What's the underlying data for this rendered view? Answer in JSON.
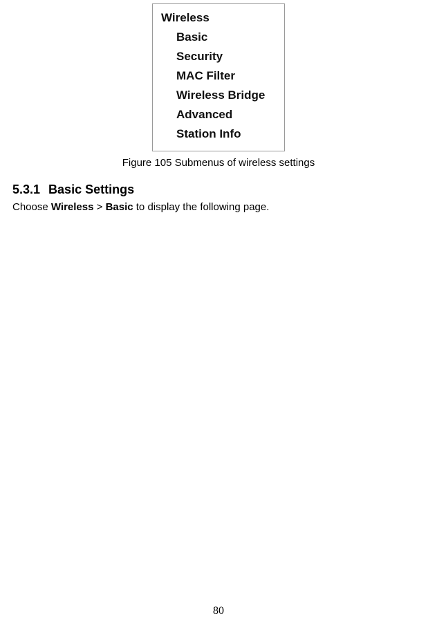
{
  "menu": {
    "parent": "Wireless",
    "items": [
      "Basic",
      "Security",
      "MAC Filter",
      "Wireless Bridge",
      "Advanced",
      "Station Info"
    ]
  },
  "figure_caption": "Figure 105 Submenus of wireless settings",
  "section": {
    "number": "5.3.1",
    "title": "Basic Settings"
  },
  "body": {
    "prefix": "Choose ",
    "bold1": "Wireless",
    "sep": " > ",
    "bold2": "Basic",
    "suffix": " to display the following page."
  },
  "page_number": "80"
}
